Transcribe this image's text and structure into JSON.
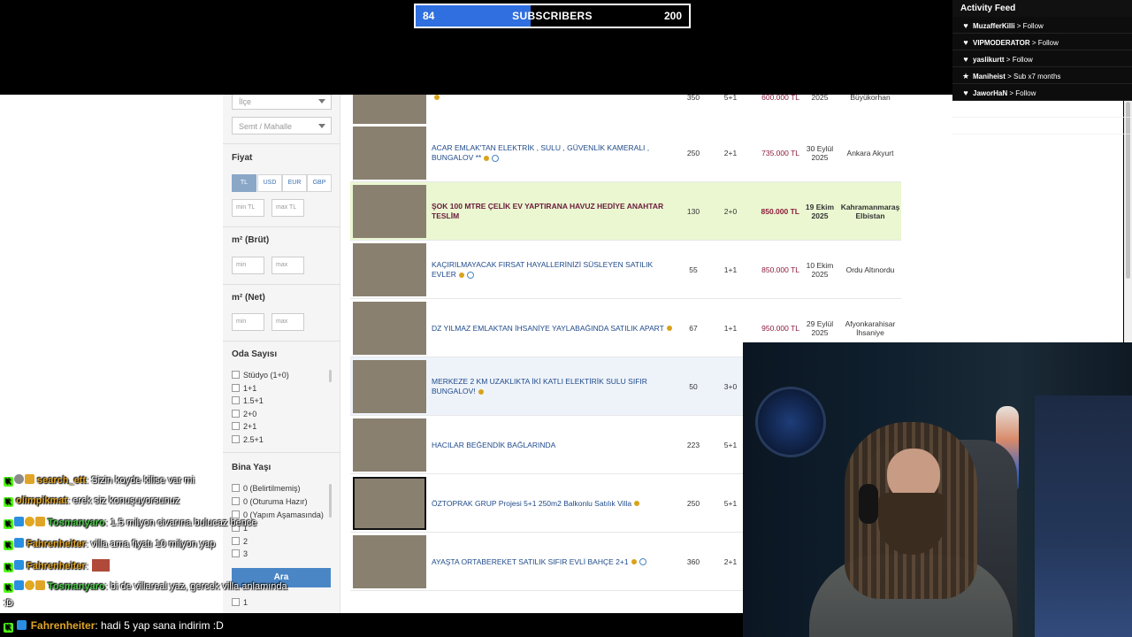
{
  "overlay": {
    "subscribers": {
      "current": "84",
      "label": "SUBSCRIBERS",
      "goal": "200",
      "progress": 0.42
    },
    "activity_feed": {
      "title": "Activity Feed",
      "items": [
        {
          "icon": "heart-icon",
          "user": "MuzafferKilli",
          "action": " > Follow"
        },
        {
          "icon": "heart-icon",
          "user": "VIPMODERATOR",
          "action": " > Follow"
        },
        {
          "icon": "heart-icon",
          "user": "yaslikurtt",
          "action": " > Follow"
        },
        {
          "icon": "star-icon",
          "user": "Maniheist",
          "action": " > Sub x7 months"
        },
        {
          "icon": "heart-icon",
          "user": "JaworHaN",
          "action": " > Follow"
        }
      ]
    },
    "chat": [
      {
        "badges": [
          "kick",
          "gray",
          "gift"
        ],
        "user": "search_ett",
        "user_color": "#e0a528",
        "message": ": Sizin koyde kilise var mi"
      },
      {
        "badges": [
          "kick"
        ],
        "user": "olimpikmat",
        "user_color": "#e0a528",
        "message": ": erek siz konuşuyorsunuz"
      },
      {
        "badges": [
          "kick",
          "blue",
          "gold",
          "gift"
        ],
        "user": "Tosmanyaro",
        "user_color": "#4ec94e",
        "message": ": 1.5 milyon civarına bulucaz bence"
      },
      {
        "badges": [
          "kick",
          "blue"
        ],
        "user": "Fahrenheiter",
        "user_color": "#e0a528",
        "message": ": villa ama fiyatı 10 milyon yap"
      },
      {
        "badges": [
          "kick",
          "blue"
        ],
        "user": "Fahrenheiter",
        "user_color": "#e0a528",
        "message": ":"
      },
      {
        "badges": [
          "kick",
          "blue",
          "gold",
          "gift"
        ],
        "user": "Tosmanyaro",
        "user_color": "#4ec94e",
        "message": ": bi de villareal yaz, gercek villa anlamında"
      },
      {
        "badges": [],
        "user": "",
        "user_color": "#ffffff",
        "message": ":D"
      }
    ],
    "chat_last": {
      "user": "Fahrenheiter",
      "user_color": "#e0a528",
      "message": ": hadi 5 yap sana indirim :D"
    }
  },
  "filters": {
    "ilce_placeholder": "İlçe",
    "semt_placeholder": "Semt / Mahalle",
    "price_title": "Fiyat",
    "currencies": [
      "TL",
      "USD",
      "EUR",
      "GBP"
    ],
    "active_currency": "TL",
    "min_price": "min TL",
    "max_price": "max TL",
    "brut_title": "m² (Brüt)",
    "net_title": "m² (Net)",
    "min": "min",
    "max": "max",
    "rooms_title": "Oda Sayısı",
    "rooms": [
      "Stüdyo (1+0)",
      "1+1",
      "1.5+1",
      "2+0",
      "2+1",
      "2.5+1"
    ],
    "age_title": "Bina Yaşı",
    "ages": [
      "0 (Belirtilmemiş)",
      "0 (Oturuma Hazır)",
      "0 (Yapım Aşamasında)",
      "1",
      "2",
      "3"
    ],
    "floor_items": [
      "1"
    ],
    "search_button": "Ara"
  },
  "listings": [
    {
      "title": "",
      "m2": "350",
      "rooms": "5+1",
      "price": "600.000 TL",
      "date": "2025",
      "loc": "Büyükorhan",
      "thumb": "t-land",
      "style": "",
      "pin": true,
      "play": false
    },
    {
      "title": "ACAR EMLAK'TAN ELEKTRİK , SULU , GÜVENLİK KAMERALI , BUNGALOV **",
      "m2": "250",
      "rooms": "2+1",
      "price": "735.000 TL",
      "date": "30 Eylül 2025",
      "loc": "Ankara Akyurt",
      "thumb": "t-house",
      "style": "",
      "pin": true,
      "play": true
    },
    {
      "title": "ŞOK 100 MTRE ÇELİK EV YAPTIRANA HAVUZ HEDİYE ANAHTAR TESLİM",
      "m2": "130",
      "rooms": "2+0",
      "price": "850.000 TL",
      "date": "19 Ekim 2025",
      "loc": "Kahramanmaraş Elbistan",
      "thumb": "t-pool",
      "style": "hl",
      "pin": false,
      "play": false
    },
    {
      "title": "KAÇIRILMAYACAK FIRSAT HAYALLERİNİZİ SÜSLEYEN SATILIK EVLER",
      "m2": "55",
      "rooms": "1+1",
      "price": "850.000 TL",
      "date": "10 Ekim 2025",
      "loc": "Ordu Altınordu",
      "thumb": "t-aframe",
      "style": "",
      "pin": true,
      "play": true
    },
    {
      "title": "DZ YILMAZ EMLAKTAN İHSANİYE YAYLABAĞINDA SATILIK APART",
      "m2": "67",
      "rooms": "1+1",
      "price": "950.000 TL",
      "date": "29 Eylül 2025",
      "loc": "Afyonkarahisar İhsaniye",
      "thumb": "t-kitchen",
      "style": "",
      "pin": true,
      "play": false
    },
    {
      "title": "MERKEZE 2 KM UZAKLIKTA İKİ KATLI ELEKTİRİK SULU SIFIR BUNGALOV!",
      "m2": "50",
      "rooms": "3+0",
      "price": "",
      "date": "",
      "loc": "",
      "thumb": "t-wood",
      "style": "blue",
      "pin": true,
      "play": false
    },
    {
      "title": "HACILAR BEĞENDİK BAĞLARINDA",
      "m2": "223",
      "rooms": "5+1",
      "price": "",
      "date": "",
      "loc": "",
      "thumb": "t-villa",
      "style": "",
      "pin": false,
      "play": false
    },
    {
      "title": "ÖZTOPRAK GRUP Projesi 5+1 250m2 Balkonlu Satılık Villa",
      "m2": "250",
      "rooms": "5+1",
      "price": "",
      "date": "",
      "loc": "",
      "thumb": "t-plan",
      "style": "",
      "pin": true,
      "play": false
    },
    {
      "title": "AYAŞTA ORTABEREKET SATILIK SIFIR EVLİ BAHÇE 2+1",
      "m2": "360",
      "rooms": "2+1",
      "price": "",
      "date": "",
      "loc": "",
      "thumb": "t-road",
      "style": "",
      "pin": true,
      "play": true
    }
  ]
}
